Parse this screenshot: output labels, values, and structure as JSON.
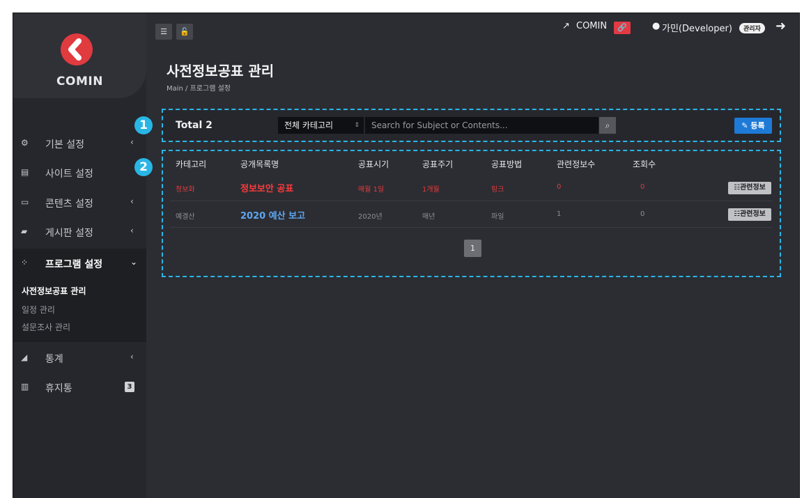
{
  "brand": {
    "name": "COMIN",
    "logo_color": "#e03b3f"
  },
  "sidebar": {
    "items": [
      {
        "label": "기본 설정",
        "icon": "gears-icon",
        "has_chevron": true
      },
      {
        "label": "사이트 설정",
        "icon": "server-icon",
        "has_chevron": false
      },
      {
        "label": "콘텐츠 설정",
        "icon": "window-icon",
        "has_chevron": true
      },
      {
        "label": "게시판 설정",
        "icon": "comments-icon",
        "has_chevron": true
      },
      {
        "label": "프로그램 설정",
        "icon": "sitemap-icon",
        "has_chevron": true,
        "expanded": true
      },
      {
        "label": "통계",
        "icon": "area-chart-icon",
        "has_chevron": true
      },
      {
        "label": "휴지통",
        "icon": "trash-icon",
        "badge": "3"
      }
    ],
    "submenu": [
      "사전정보공표 관리",
      "일정 관리",
      "설문조사 관리"
    ],
    "active_submenu": "사전정보공표 관리"
  },
  "topbar": {
    "site_link_label": "COMIN",
    "user_label": "가민(Developer)",
    "role_badge": "관리자"
  },
  "page": {
    "title": "사전정보공표 관리",
    "breadcrumb": "Main  /  프로그램 설정"
  },
  "annotations": {
    "one": "1",
    "two": "2",
    "color": "#29b6e6"
  },
  "toolbar": {
    "total_label": "Total 2",
    "category_select": "전체 카테고리",
    "search_placeholder": "Search for Subject or Contents...",
    "register_label": "등록"
  },
  "table": {
    "headers": [
      "카테고리",
      "공개목록명",
      "공표시기",
      "공표주기",
      "공표방법",
      "관련정보수",
      "조회수"
    ],
    "rows": [
      {
        "category": "정보화",
        "title": "정보보안 공표",
        "timing": "매월 1일",
        "cycle": "1개월",
        "method": "링크",
        "related": "0",
        "views": "0",
        "action": "관련정보",
        "style": "highlight"
      },
      {
        "category": "예결산",
        "title": "2020 예산 보고",
        "timing": "2020년",
        "cycle": "매년",
        "method": "파일",
        "related": "1",
        "views": "0",
        "action": "관련정보",
        "style": "normal"
      }
    ]
  },
  "pagination": {
    "current": "1"
  }
}
